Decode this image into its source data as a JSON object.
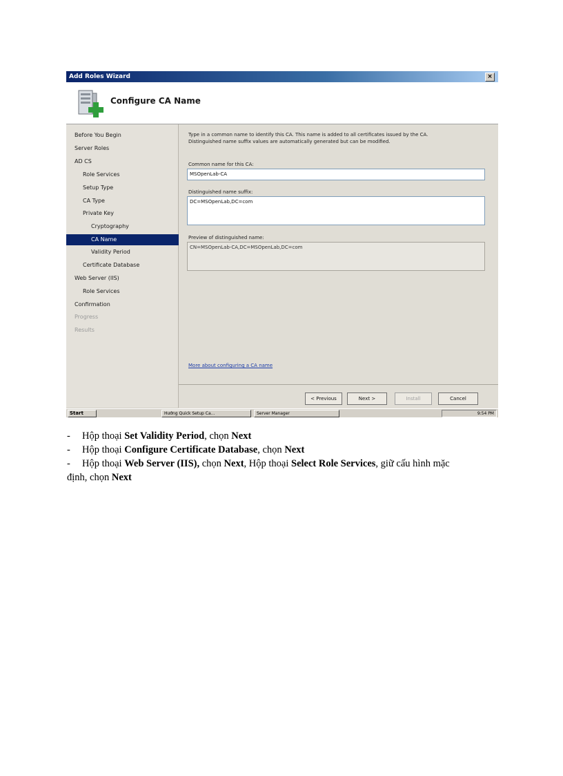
{
  "wizard": {
    "window_title": "Add Roles Wizard",
    "close_glyph": "×",
    "page_title": "Configure CA Name",
    "header_icon": "server-with-green-plus-icon",
    "nav": [
      {
        "label": "Before You Begin",
        "state": "normal"
      },
      {
        "label": "Server Roles",
        "state": "normal"
      },
      {
        "label": "AD CS",
        "state": "normal"
      },
      {
        "label": "Role Services",
        "state": "normal"
      },
      {
        "label": "Setup Type",
        "state": "normal"
      },
      {
        "label": "CA Type",
        "state": "normal"
      },
      {
        "label": "Private Key",
        "state": "normal"
      },
      {
        "label": "Cryptography",
        "state": "normal"
      },
      {
        "label": "CA Name",
        "state": "selected"
      },
      {
        "label": "Validity Period",
        "state": "normal"
      },
      {
        "label": "Certificate Database",
        "state": "normal"
      },
      {
        "label": "Web Server (IIS)",
        "state": "normal"
      },
      {
        "label": "Role Services",
        "state": "normal"
      },
      {
        "label": "Confirmation",
        "state": "normal"
      },
      {
        "label": "Progress",
        "state": "disabled"
      },
      {
        "label": "Results",
        "state": "disabled"
      }
    ],
    "intro_line1": "Type in a common name to identify this CA. This name is added to all certificates issued by the CA.",
    "intro_line2": "Distinguished name suffix values are automatically generated but can be modified.",
    "common_name_label": "Common name for this CA:",
    "common_name_value": "MSOpenLab-CA",
    "dn_suffix_label": "Distinguished name suffix:",
    "dn_suffix_value": "DC=MSOpenLab,DC=com",
    "preview_label": "Preview of distinguished name:",
    "preview_value": "CN=MSOpenLab-CA,DC=MSOpenLab,DC=com",
    "more_link": "More about configuring a CA name",
    "buttons": {
      "previous": "< Previous",
      "next": "Next >",
      "install": "Install",
      "cancel": "Cancel"
    },
    "taskbar": {
      "start": "Start",
      "task1": "Hướng Quick Setup Ca...",
      "task2": "Server Manager",
      "clock": "9:54 PM"
    }
  },
  "document": {
    "dash": "-",
    "line1": {
      "t1": "Hộp thoại ",
      "b1": "Set Validity Period",
      "t2": ", chọn ",
      "b2": "Next"
    },
    "line2": {
      "t1": "Hộp thoại ",
      "b1": "Configure Certificate Database",
      "t2": ", chọn ",
      "b2": "Next"
    },
    "line3": {
      "t1": "Hộp thoại ",
      "b1": "Web Server (IIS),",
      "t2": " chọn ",
      "b2": "Next",
      "t3": ", Hộp thoại ",
      "b3": "Select Role Services",
      "t4": ", giữ cấu hình mặc"
    },
    "line4": {
      "t1": "định, chọn ",
      "b1": "Next"
    }
  }
}
